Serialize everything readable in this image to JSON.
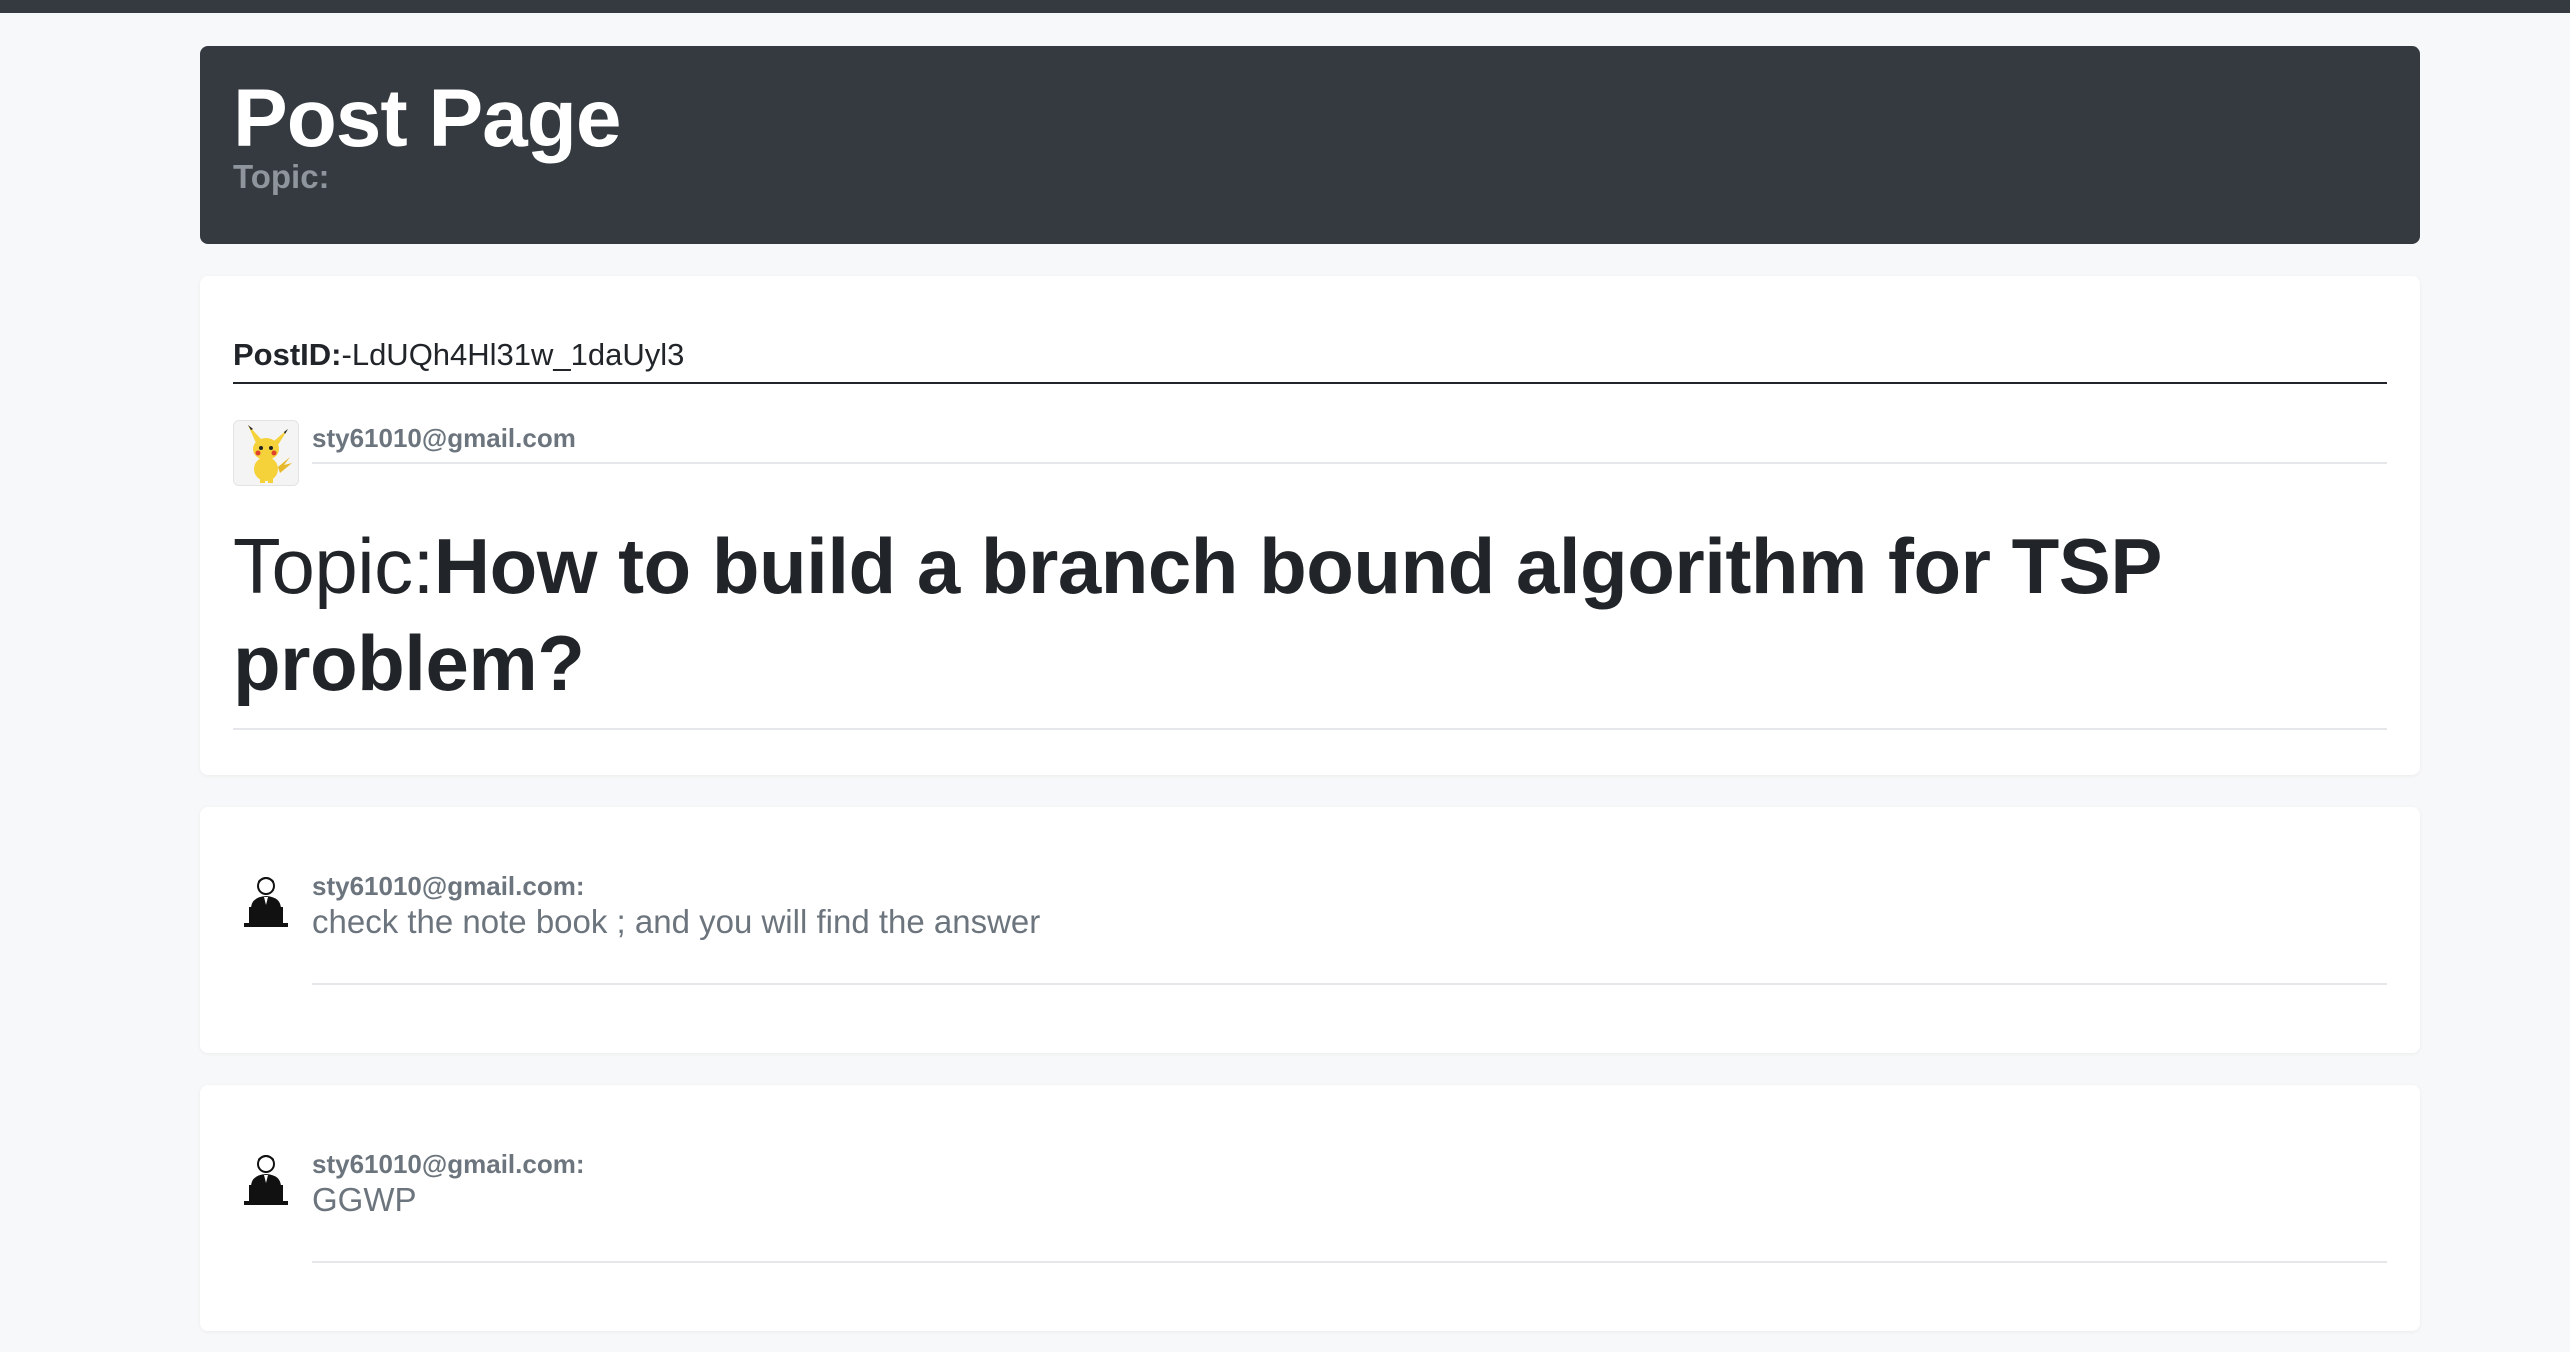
{
  "header": {
    "title": "Post Page",
    "subtitle": "Topic:"
  },
  "post": {
    "id_label": "PostID:",
    "id_value": "-LdUQh4Hl31w_1daUyl3",
    "author": "sty61010@gmail.com",
    "author_avatar_icon": "pikachu-avatar-icon",
    "topic_prefix": "Topic:",
    "topic_text": "How to build a branch bound algorithm for TSP problem?"
  },
  "comments": [
    {
      "author": "sty61010@gmail.com:",
      "text": "check the note book ; and you will find the answer",
      "avatar_icon": "user-laptop-icon"
    },
    {
      "author": "sty61010@gmail.com:",
      "text": "GGWP",
      "avatar_icon": "user-laptop-icon"
    }
  ],
  "colors": {
    "topbar": "#343a40",
    "header_bg": "#343a40",
    "page_bg": "#f7f8f9",
    "muted_text": "#6c757d"
  }
}
